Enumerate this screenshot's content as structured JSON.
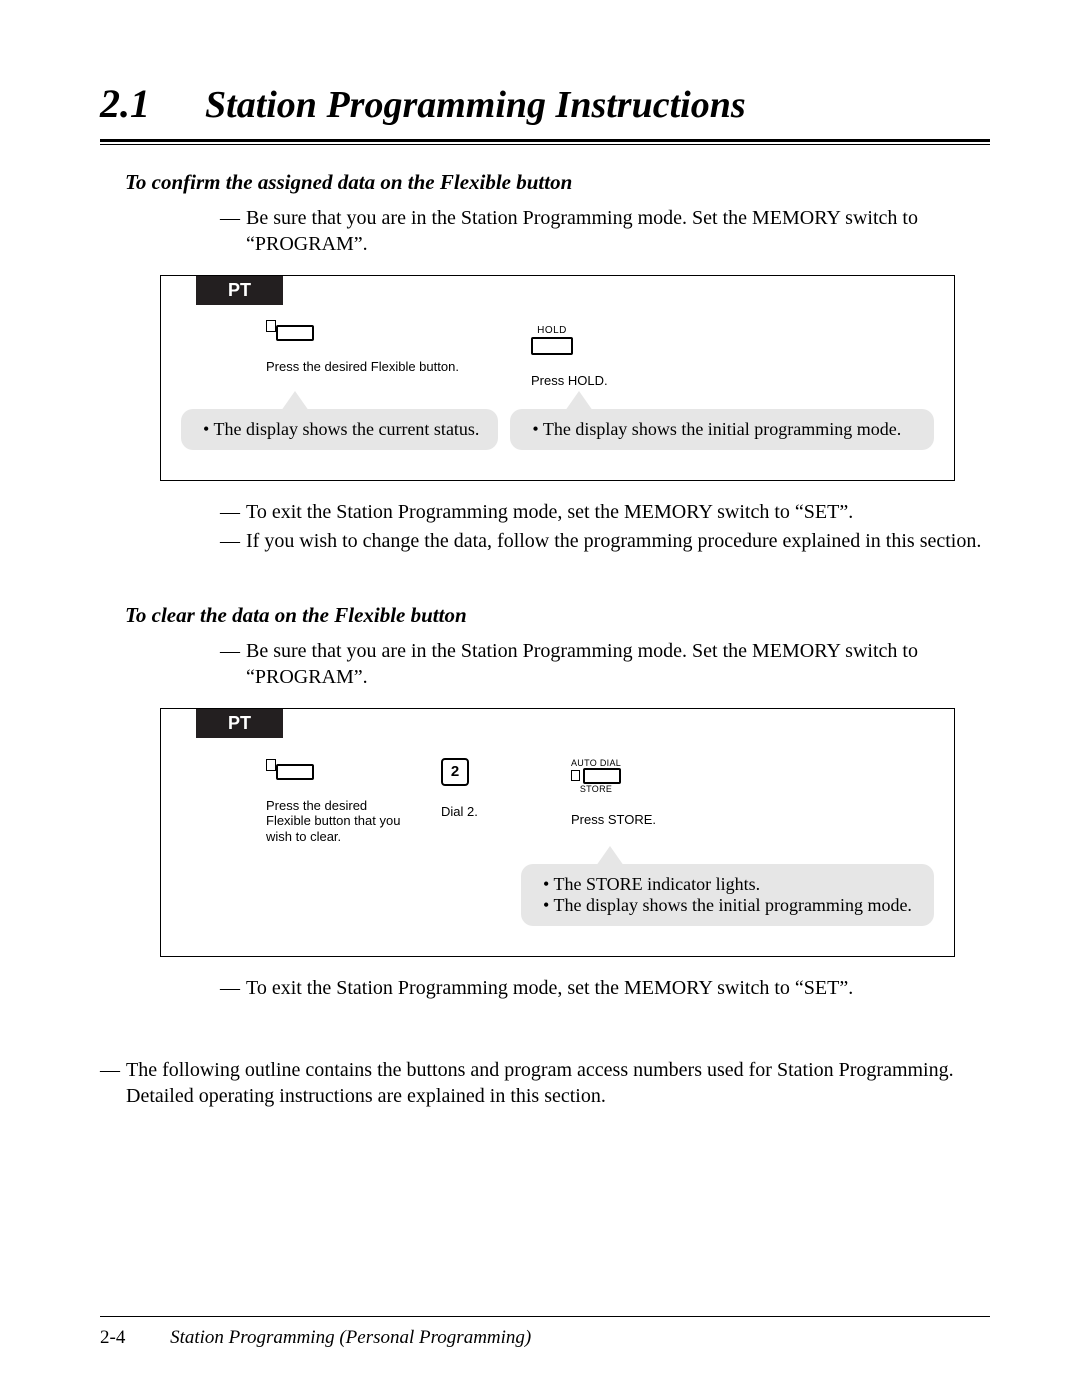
{
  "header": {
    "section_number": "2.1",
    "title": "Station Programming Instructions"
  },
  "section1": {
    "heading": "To confirm the assigned data on the Flexible button",
    "pre_note": "Be sure that you are in the Station Programming mode. Set the MEMORY switch to “PROGRAM”.",
    "pt_label": "PT",
    "step1_hold_label": "HOLD",
    "step1_cap1": "Press the desired Flexible button.",
    "step1_cap2": "Press HOLD.",
    "callout1": "The display shows the current status.",
    "callout2": "The display shows the initial programming mode.",
    "post_note1": "To exit the Station Programming mode, set the MEMORY switch to “SET”.",
    "post_note2": "If you wish to change the data, follow the programming procedure explained in this section."
  },
  "section2": {
    "heading": "To clear the data on the Flexible button",
    "pre_note": "Be sure that you are in the Station Programming mode. Set the MEMORY switch to “PROGRAM”.",
    "pt_label": "PT",
    "key_label": "2",
    "auto_dial_label": "AUTO DIAL",
    "store_label": "STORE",
    "cap1": "Press the desired Flexible button that you wish to clear.",
    "cap2": "Dial 2.",
    "cap3": "Press STORE.",
    "callout_a": "The STORE indicator lights.",
    "callout_b": "The display shows the initial programming mode.",
    "post_note": "To exit the Station Programming mode, set the MEMORY switch to “SET”."
  },
  "outline_note": "The following outline contains the buttons and program access numbers used for Station Programming. Detailed operating instructions are explained in this section.",
  "footer": {
    "page": "2-4",
    "chapter": "Station Programming (Personal Programming)"
  }
}
